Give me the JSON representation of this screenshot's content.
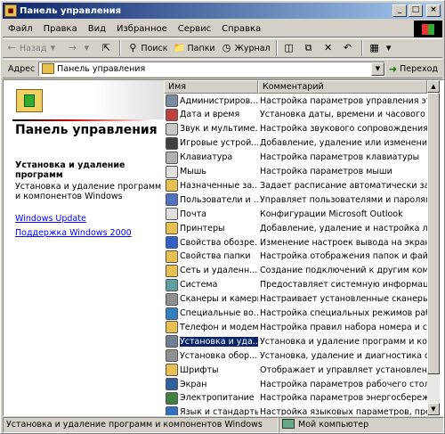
{
  "window": {
    "title": "Панель управления"
  },
  "menu": [
    "Файл",
    "Правка",
    "Вид",
    "Избранное",
    "Сервис",
    "Справка"
  ],
  "toolbar": {
    "back": "Назад",
    "search": "Поиск",
    "folders": "Папки",
    "history": "Журнал"
  },
  "address": {
    "label": "Адрес",
    "value": "Панель управления",
    "go": "Переход"
  },
  "left_pane": {
    "title": "Панель управления",
    "subtitle": "Установка и удаление программ",
    "description": "Установка и удаление программ и компонентов Windows",
    "links": [
      "Windows Update",
      "Поддержка Windows 2000"
    ]
  },
  "list": {
    "columns": [
      "Имя",
      "Комментарий"
    ],
    "items": [
      {
        "name": "Администриров...",
        "comment": "Настройка параметров управления этого компьютера",
        "color": "#7a8aa0"
      },
      {
        "name": "Дата и время",
        "comment": "Установка даты, времени и часового пояса д",
        "color": "#c04040"
      },
      {
        "name": "Звук и мультиме...",
        "comment": "Настройка звукового сопровождения событий",
        "color": "#c8c8c8"
      },
      {
        "name": "Игровые устрой...",
        "comment": "Добавление, удаление или изменение параметров",
        "color": "#404040"
      },
      {
        "name": "Клавиатура",
        "comment": "Настройка параметров клавиатуры",
        "color": "#b0b0b0"
      },
      {
        "name": "Мышь",
        "comment": "Настройка параметров мыши",
        "color": "#e0e0e0"
      },
      {
        "name": "Назначенные за...",
        "comment": "Задает расписание автоматически запускаемых",
        "color": "#e8c050"
      },
      {
        "name": "Пользователи и ...",
        "comment": "Управляет пользователями и паролями на этом",
        "color": "#5070c0"
      },
      {
        "name": "Почта",
        "comment": "Конфигурации Microsoft Outlook",
        "color": "#e0e0e0"
      },
      {
        "name": "Принтеры",
        "comment": "Добавление, удаление и настройка локальных",
        "color": "#e8c050"
      },
      {
        "name": "Свойства обозре...",
        "comment": "Изменение настроек вывода на экран и подкл",
        "color": "#3060c0"
      },
      {
        "name": "Свойства папки",
        "comment": "Настройка отображения папок и файлов, соп",
        "color": "#e8c050"
      },
      {
        "name": "Сеть и удаленн...",
        "comment": "Создание подключений к другим компьютерам",
        "color": "#e8c050"
      },
      {
        "name": "Система",
        "comment": "Предоставляет системную информацию и изм",
        "color": "#60a0a0"
      },
      {
        "name": "Сканеры и камеры",
        "comment": "Настраивает установленные сканеры и камер",
        "color": "#909090"
      },
      {
        "name": "Специальные во...",
        "comment": "Настройка специальных режимов работы для",
        "color": "#3080c0"
      },
      {
        "name": "Телефон и модем",
        "comment": "Настройка правил набора номера и свойств м",
        "color": "#e8c050"
      },
      {
        "name": "Установка и уда...",
        "comment": "Установка и удаление программ и компонент",
        "color": "#708090"
      },
      {
        "name": "Установка обор...",
        "comment": "Установка, удаление и диагностика оборудо",
        "color": "#909090"
      },
      {
        "name": "Шрифты",
        "comment": "Отображает и управляет установленными шр",
        "color": "#e8c050"
      },
      {
        "name": "Экран",
        "comment": "Настройка параметров рабочего стола и экра",
        "color": "#3060a0"
      },
      {
        "name": "Электропитание",
        "comment": "Настройка параметров энергосбережения для",
        "color": "#408040"
      },
      {
        "name": "Язык и стандарты",
        "comment": "Настройка языковых параметров, представле",
        "color": "#3070c0"
      }
    ],
    "selected_index": 17
  },
  "status": {
    "left": "Установка и удаление программ и компонентов Windows",
    "right": "Мой компьютер"
  }
}
